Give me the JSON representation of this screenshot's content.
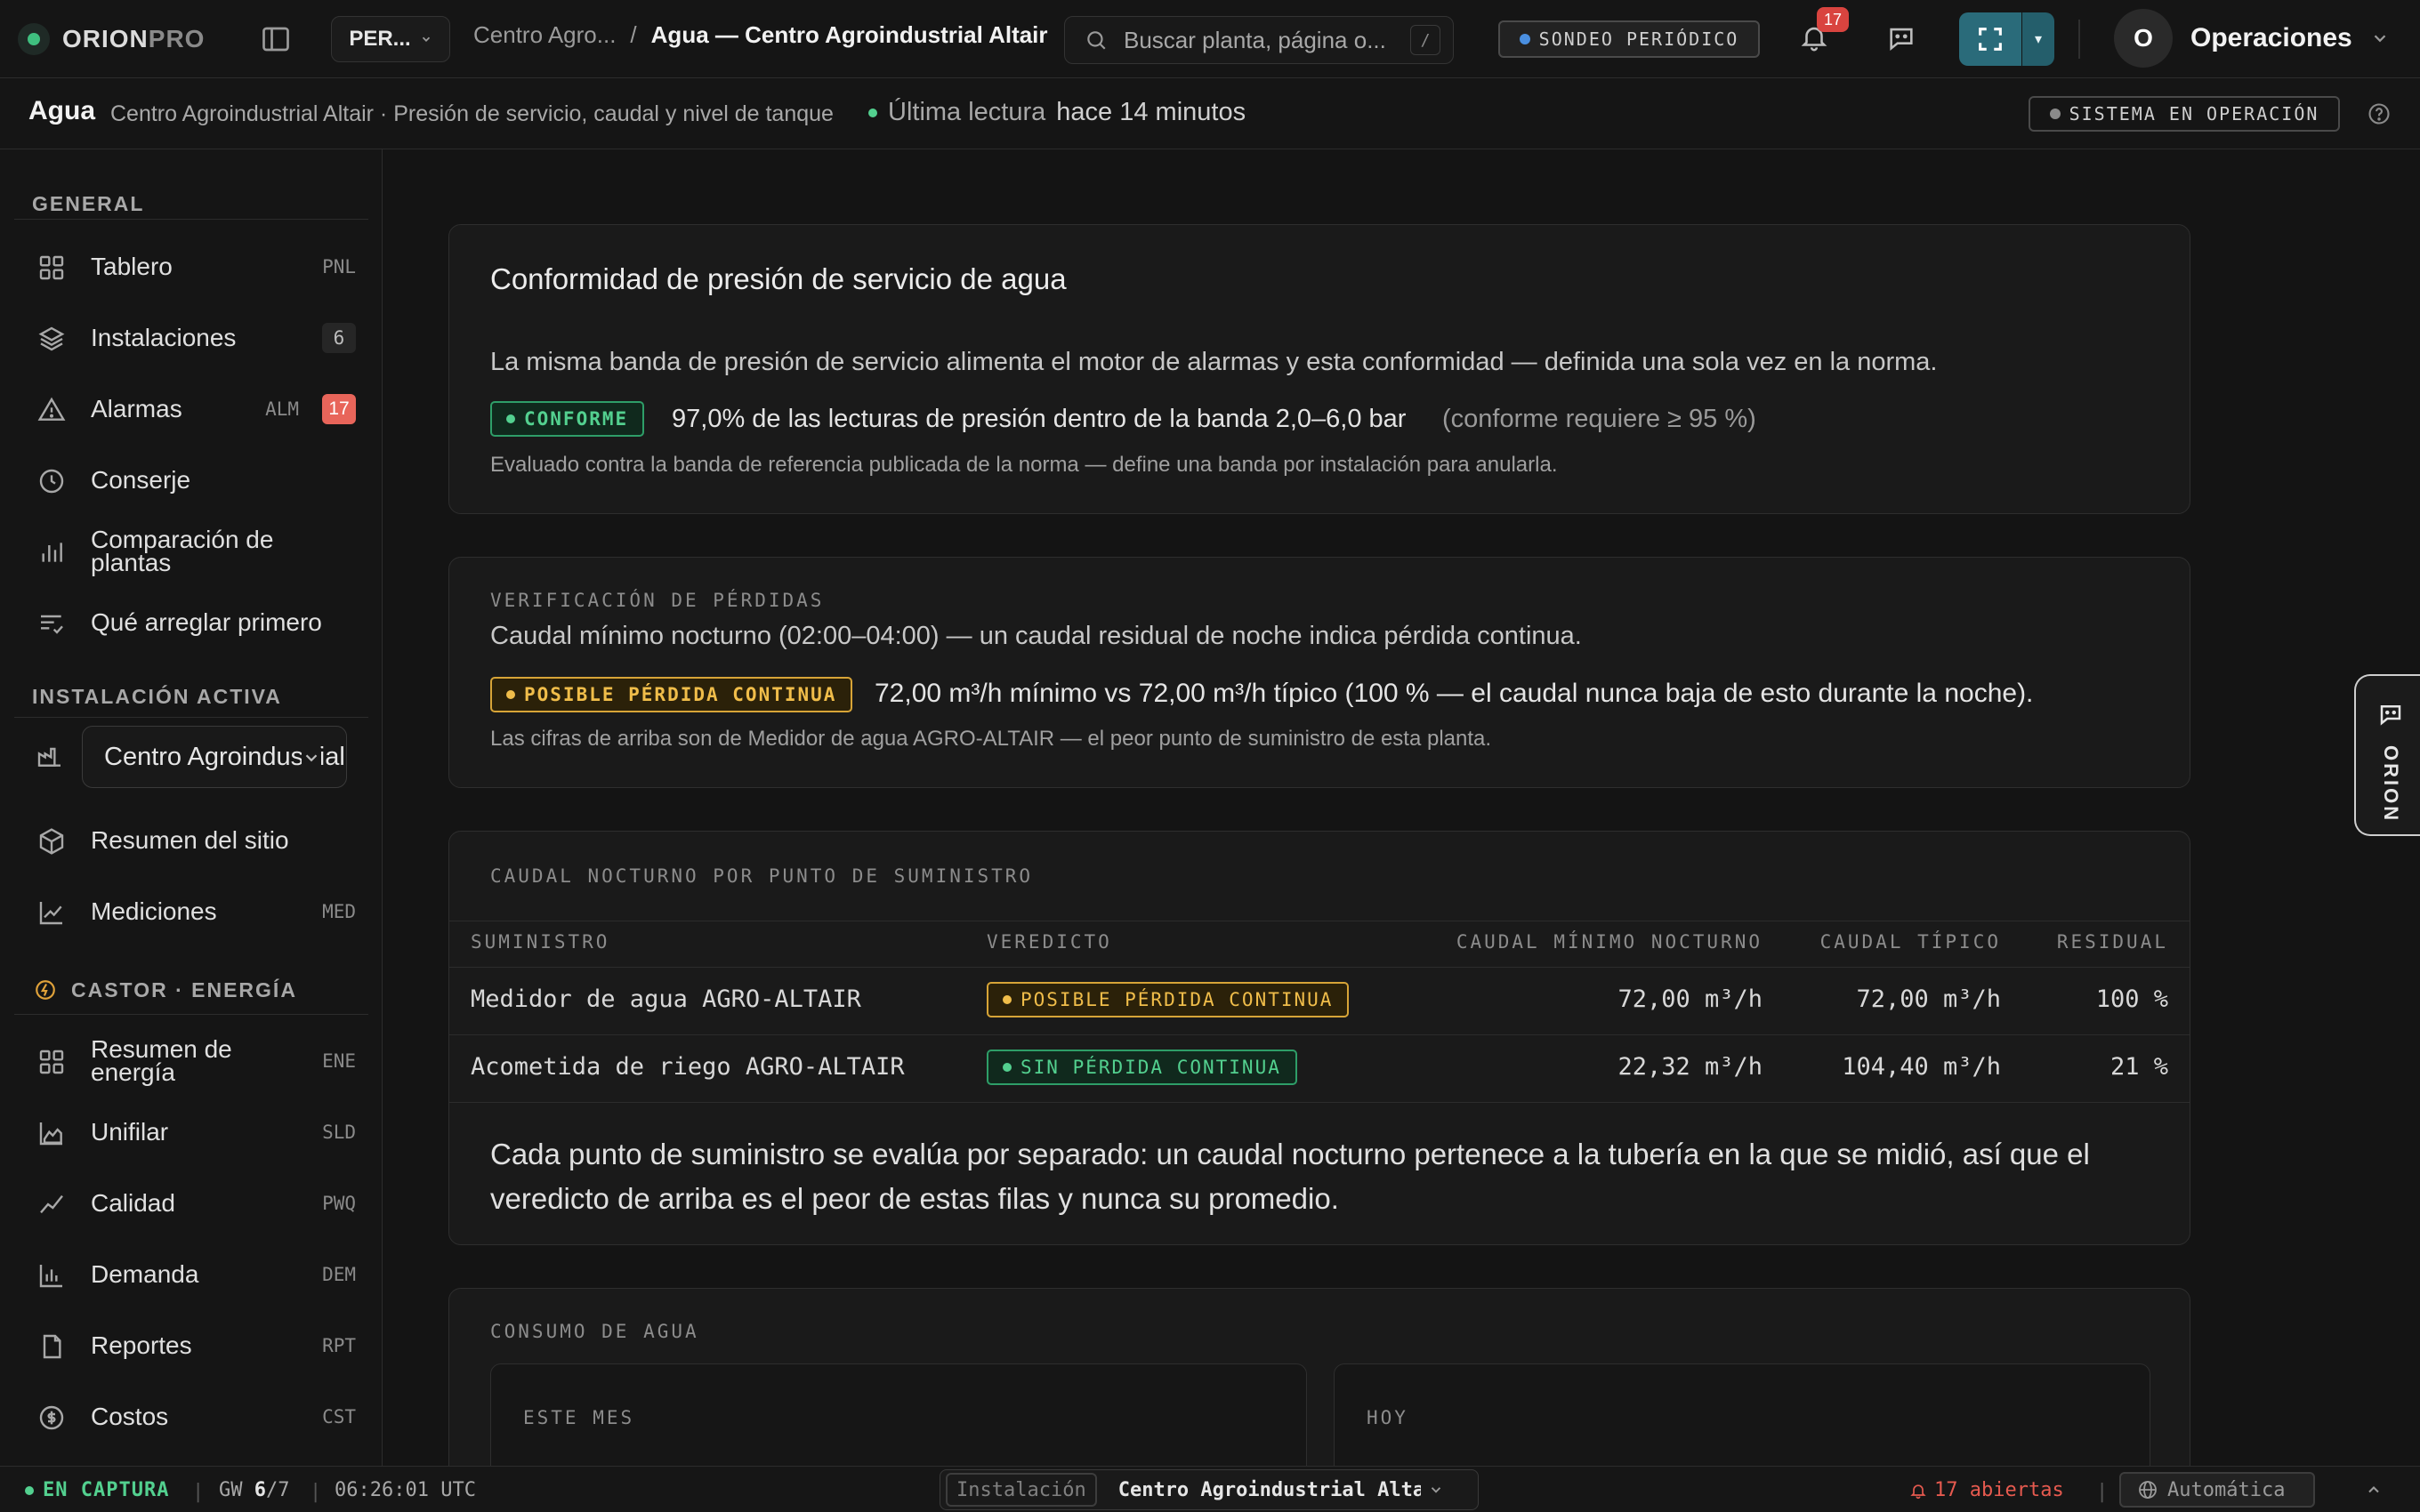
{
  "topbar": {
    "logo_main": "ORION",
    "logo_sub": "PRO",
    "workspace_label": "PER...",
    "breadcrumb_parent": "Centro Agro...",
    "breadcrumb_sep": "/",
    "breadcrumb_current": "Agua — Centro Agroindustrial Altair",
    "search_placeholder": "Buscar planta, página o...",
    "search_shortcut": "/",
    "polling_label": "SONDEO PERIÓDICO",
    "notifications_count": "17",
    "fullscreen_dropdown": "▾",
    "user_initial": "O",
    "user_name": "Operaciones"
  },
  "subheader": {
    "title": "Agua",
    "description": "Centro Agroindustrial Altair · Presión de servicio, caudal y nivel de tanque",
    "last_reading_label": "Última lectura",
    "last_reading_value": "hace 14 minutos",
    "system_status": "SISTEMA EN OPERACIÓN"
  },
  "sidebar": {
    "general_title": "GENERAL",
    "general_items": [
      {
        "label": "Tablero",
        "code": "PNL"
      },
      {
        "label": "Instalaciones",
        "count": "6"
      },
      {
        "label": "Alarmas",
        "code": "ALM",
        "count": "17"
      },
      {
        "label": "Conserje"
      },
      {
        "label": "Comparación de plantas"
      },
      {
        "label": "Qué arreglar primero"
      }
    ],
    "active_title": "INSTALACIÓN ACTIVA",
    "active_site": "Centro Agroindustrial Altair",
    "active_items": [
      {
        "label": "Resumen del sitio"
      },
      {
        "label": "Mediciones",
        "code": "MED"
      }
    ],
    "energy_title": "CASTOR · ENERGÍA",
    "energy_items": [
      {
        "label": "Resumen de energía",
        "code": "ENE"
      },
      {
        "label": "Unifilar",
        "code": "SLD"
      },
      {
        "label": "Calidad",
        "code": "PWQ"
      },
      {
        "label": "Demanda",
        "code": "DEM"
      },
      {
        "label": "Reportes",
        "code": "RPT"
      },
      {
        "label": "Costos",
        "code": "CST"
      }
    ]
  },
  "pressure_card": {
    "title": "Conformidad de presión de servicio de agua",
    "description": "La misma banda de presión de servicio alimenta el motor de alarmas y esta conformidad — definida una sola vez en la norma.",
    "badge": "CONFORME",
    "result": "97,0% de las lecturas de presión dentro de la banda 2,0–6,0 bar",
    "requirement": "(conforme requiere ≥ 95 %)",
    "note": "Evaluado contra la banda de referencia publicada de la norma — define una banda por instalación para anularla."
  },
  "loss_card": {
    "kicker": "VERIFICACIÓN DE PÉRDIDAS",
    "description": "Caudal mínimo nocturno (02:00–04:00) — un caudal residual de noche indica pérdida continua.",
    "badge": "POSIBLE PÉRDIDA CONTINUA",
    "result": "72,00 m³/h mínimo vs 72,00 m³/h típico (100 % — el caudal nunca baja de esto durante la noche).",
    "note": "Las cifras de arriba son de Medidor de agua AGRO-ALTAIR — el peor punto de suministro de esta planta."
  },
  "night_flow": {
    "kicker": "CAUDAL NOCTURNO POR PUNTO DE SUMINISTRO",
    "columns": [
      "SUMINISTRO",
      "VEREDICTO",
      "CAUDAL MÍNIMO NOCTURNO",
      "CAUDAL TÍPICO",
      "RESIDUAL"
    ],
    "rows": [
      {
        "supply": "Medidor de agua AGRO-ALTAIR",
        "verdict": "POSIBLE PÉRDIDA CONTINUA",
        "min_flow": "72,00 m³/h",
        "typical": "72,00 m³/h",
        "residual": "100 %"
      },
      {
        "supply": "Acometida de riego AGRO-ALTAIR",
        "verdict": "SIN PÉRDIDA CONTINUA",
        "min_flow": "22,32 m³/h",
        "typical": "104,40 m³/h",
        "residual": "21 %"
      }
    ],
    "footnote": "Cada punto de suministro se evalúa por separado: un caudal nocturno pertenece a la tubería en la que se midió, así que el veredicto de arriba es el peor de estas filas y nunca su promedio."
  },
  "consumption": {
    "kicker": "CONSUMO DE AGUA",
    "month_label": "ESTE MES",
    "today_label": "HOY"
  },
  "orion_tab": "ORION",
  "statusbar": {
    "capture": "EN CAPTURA",
    "gw_label": "GW",
    "gw_value": "6",
    "gw_total": "/7",
    "time": "06:26:01 UTC",
    "installation_label": "Instalación",
    "installation_value": "Centro Agroindustrial Altair",
    "open_alarms": "17 abiertas",
    "auto": "Automática"
  },
  "colors": {
    "accent": "#2a6b7a",
    "ok_green": "#53d08f",
    "warn_amber": "#f0bd4a",
    "alarm_red": "#d9443f",
    "polling_blue": "#4a8fe0"
  }
}
